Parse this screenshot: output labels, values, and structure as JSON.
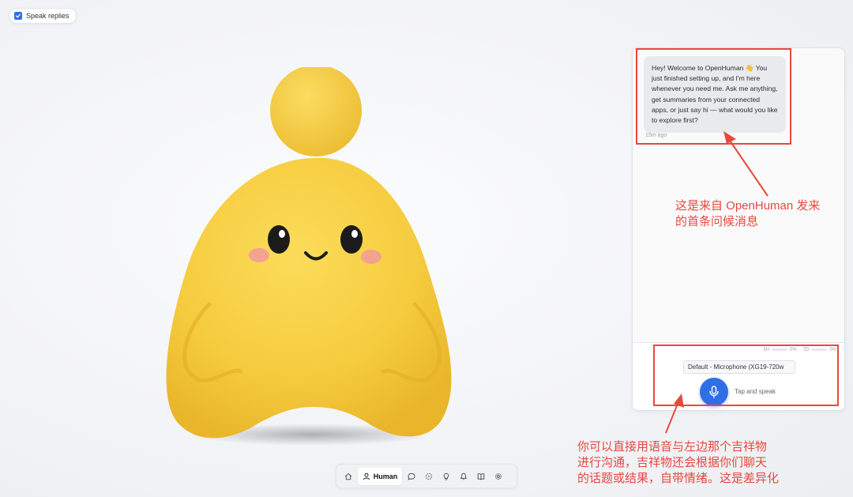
{
  "toggle": {
    "label": "Speak replies",
    "checked": true
  },
  "chat": {
    "message": "Hey! Welcome to OpenHuman 👋 You just finished setting up, and I'm here whenever you need me. Ask me anything, get summaries from your connected apps, or just say hi — what would you like to explore first?",
    "time": "15m ago"
  },
  "usage": {
    "first_label": "5H",
    "first_value": "0%",
    "second_label": "7D",
    "second_value": "0%"
  },
  "voice": {
    "device": "Default - Microphone (XG19-720w",
    "hint": "Tap and speak"
  },
  "annotations": {
    "top_line1": "这是来自 OpenHuman 发来",
    "top_line2": "的首条问候消息",
    "bottom_line1": "你可以直接用语音与左边那个吉祥物",
    "bottom_line2": "进行沟通，吉祥物还会根据你们聊天",
    "bottom_line3": "的话题或结果，自带情绪。这是差异化"
  },
  "nav": {
    "active_label": "Human"
  },
  "colors": {
    "accent": "#2f6fe6",
    "annotation": "#e8483f",
    "mascot": "#f6cc3f"
  }
}
